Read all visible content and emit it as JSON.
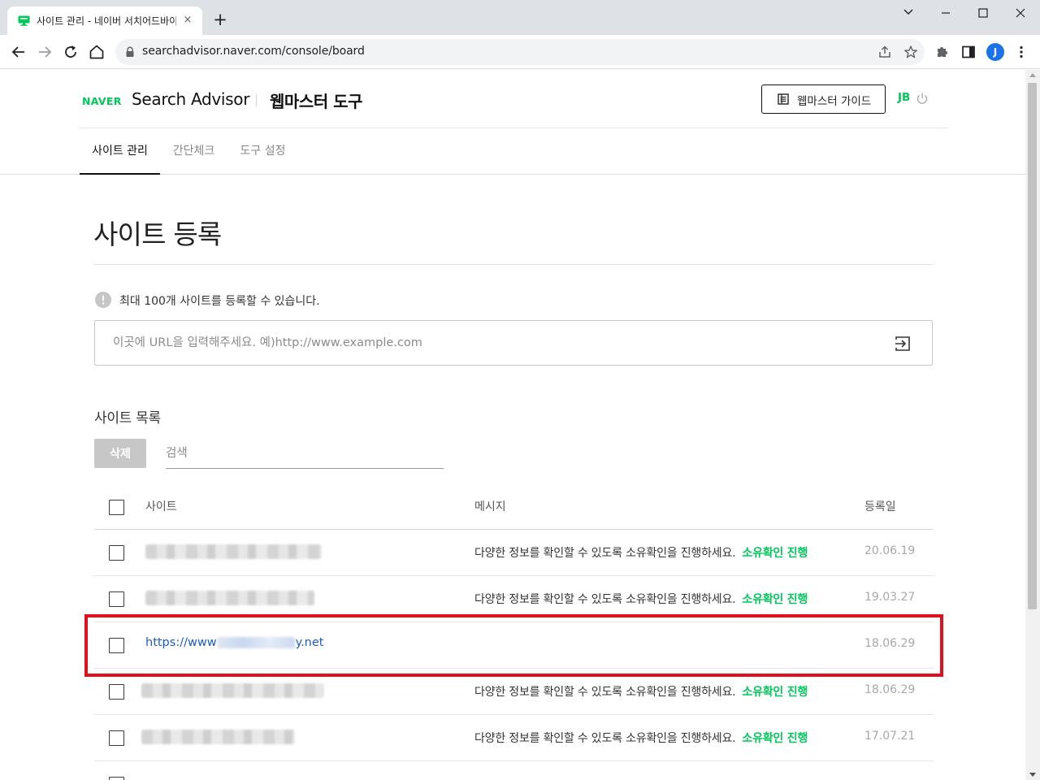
{
  "browser": {
    "tab_title": "사이트 관리 - 네이버 서치어드바이저",
    "tab_close": "×",
    "new_tab": "+",
    "url": "searchadvisor.naver.com/console/board",
    "profile_initial": "J",
    "colors": {
      "tabstrip": "#dee1e6",
      "profile": "#1a73e8"
    }
  },
  "header": {
    "naver_logo": "NAVER",
    "service_name": "Search Advisor",
    "section_name": "웹마스터 도구",
    "guide_button": "웹마스터 가이드",
    "user_initials": "JB",
    "brand_color": "#03c75a"
  },
  "nav": {
    "tabs": [
      {
        "label": "사이트 관리",
        "active": true
      },
      {
        "label": "간단체크",
        "active": false
      },
      {
        "label": "도구 설정",
        "active": false
      }
    ]
  },
  "main": {
    "page_title": "사이트 등록",
    "notice": "최대 100개 사이트를 등록할 수 있습니다.",
    "url_placeholder": "이곳에 URL을 입력해주세요. 예)http://www.example.com",
    "url_value": "",
    "list_title": "사이트 목록",
    "delete_button": "삭제",
    "search_placeholder": "검색",
    "search_value": ""
  },
  "table": {
    "headers": {
      "site": "사이트",
      "message": "메시지",
      "date": "등록일"
    },
    "rows": [
      {
        "site": "",
        "blurred": true,
        "message": "다양한 정보를 확인할 수 있도록 소유확인을 진행하세요.",
        "action": "소유확인 진행",
        "date": "20.06.19"
      },
      {
        "site": "",
        "blurred": true,
        "message": "다양한 정보를 확인할 수 있도록 소유확인을 진행하세요.",
        "action": "소유확인 진행",
        "date": "19.03.27"
      },
      {
        "site_prefix": "https://www",
        "site_suffix": "y.net",
        "blurred": false,
        "message": "",
        "action": "",
        "date": "18.06.29",
        "highlighted": true
      },
      {
        "site": "",
        "blurred": true,
        "message": "다양한 정보를 확인할 수 있도록 소유확인을 진행하세요.",
        "action": "소유확인 진행",
        "date": "18.06.29"
      },
      {
        "site": "",
        "blurred": true,
        "message": "다양한 정보를 확인할 수 있도록 소유확인을 진행하세요.",
        "action": "소유확인 진행",
        "date": "17.07.21"
      }
    ],
    "highlight_color": "#e0101d"
  }
}
